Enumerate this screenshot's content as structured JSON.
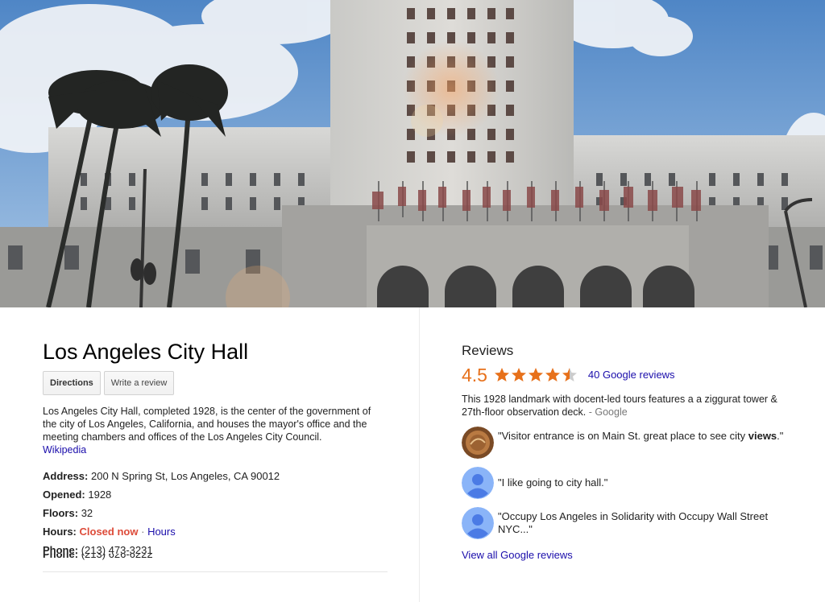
{
  "place": {
    "title": "Los Angeles City Hall",
    "buttons": {
      "directions": "Directions",
      "write_review": "Write a review"
    },
    "description": "Los Angeles City Hall, completed 1928, is the center of the government of the city of Los Angeles, California, and houses the mayor's office and the meeting chambers and offices of the Los Angeles City Council.",
    "source_link": "Wikipedia",
    "facts": {
      "address_label": "Address:",
      "address": "200 N Spring St, Los Angeles, CA 90012",
      "opened_label": "Opened:",
      "opened": "1928",
      "floors_label": "Floors:",
      "floors": "32",
      "hours_label": "Hours:",
      "hours_status": "Closed now",
      "hours_sep": "·",
      "hours_link": "Hours",
      "phone_label": "Phone:",
      "phone": "(213) 473-3231",
      "phone2_label": "Phone:",
      "phone2": "(213) 626-6222"
    }
  },
  "reviews": {
    "heading": "Reviews",
    "rating": "4.5",
    "rating_value": 4.5,
    "count_link": "40 Google reviews",
    "summary": "This 1928 landmark with docent-led tours features a a ziggurat tower & 27th-floor observation deck.",
    "summary_source": "- Google",
    "items": [
      {
        "text_before": "\"Visitor entrance is on Main St. great place to see city ",
        "text_bold": "views",
        "text_after": ".\"",
        "avatar": "photo-avatar-icon"
      },
      {
        "text": "\"I like going to city hall.\"",
        "avatar": "default-user-icon"
      },
      {
        "text": "\"Occupy Los Angeles in Solidarity with Occupy Wall Street NYC...\"",
        "avatar": "default-user-icon"
      }
    ],
    "view_all": "View all Google reviews"
  },
  "colors": {
    "accent_orange": "#e7711b",
    "link_blue": "#1a0dab",
    "closed_red": "#dd4b39"
  }
}
